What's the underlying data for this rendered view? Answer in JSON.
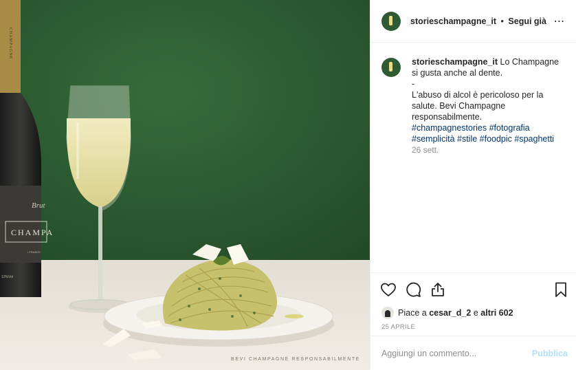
{
  "photo": {
    "caption": "BEVI CHAMPAGNE RESPONSABILMENTE",
    "bottle_label_main": "CHAMPA",
    "bottle_label_script": "Brut",
    "bottle_neck_text": "CHAMPAGNE",
    "bottle_abv": "12%Vol",
    "bottle_small_text": "• FRANCE",
    "colors": {
      "background": "#2c5a30",
      "table": "#ece8e0",
      "plate": "#f2f0ea",
      "pasta": "#c9c36f",
      "wine": "#e7e0a2"
    }
  },
  "header": {
    "username": "storieschampagne_it",
    "separator": "•",
    "follow_label": "Segui già",
    "more_icon": "⋯"
  },
  "comment": {
    "username": "storieschampagne_it",
    "text_line1": "Lo Champagne si gusta anche al dente.",
    "text_line2": "-",
    "text_line3": "L'abuso di alcol è pericoloso per la salute. Bevi Champagne responsabilmente.",
    "hashtags": "#champagnestories #fotografia #semplicità #stile #foodpic #spaghetti",
    "time": "26 sett."
  },
  "actions": {
    "icons": [
      "heart-icon",
      "comment-icon",
      "share-icon",
      "bookmark-icon"
    ]
  },
  "likes": {
    "prefix": "Piace a",
    "user": "cesar_d_2",
    "middle": "e",
    "others": "altri 602"
  },
  "date": "25 APRILE",
  "add_comment": {
    "placeholder": "Aggiungi un commento...",
    "publish_label": "Pubblica"
  }
}
